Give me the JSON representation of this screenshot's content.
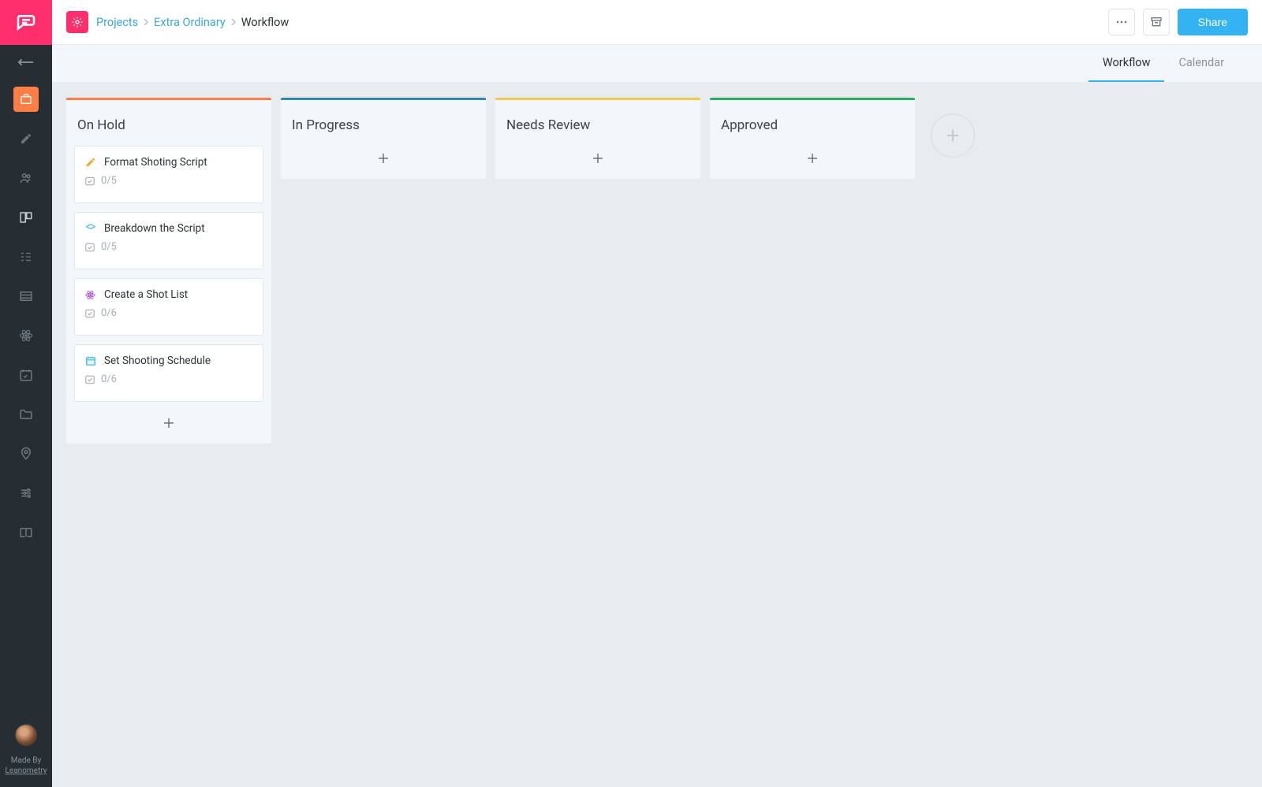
{
  "sidebar": {
    "credit_line1": "Made By",
    "credit_line2": "Leanometry"
  },
  "topbar": {
    "breadcrumb": {
      "root": "Projects",
      "project": "Extra Ordinary",
      "current": "Workflow"
    },
    "share_label": "Share"
  },
  "tabs": [
    {
      "label": "Workflow",
      "active": true
    },
    {
      "label": "Calendar",
      "active": false
    }
  ],
  "columns": [
    {
      "title": "On Hold",
      "color": "#ff7e45",
      "cards": [
        {
          "icon": "pencil",
          "icon_color": "#f5a623",
          "title": "Format Shoting Script",
          "progress": "0/5"
        },
        {
          "icon": "box",
          "icon_color": "#4ac1e0",
          "title": "Breakdown the Script",
          "progress": "0/5"
        },
        {
          "icon": "atom",
          "icon_color": "#b865d6",
          "title": "Create a Shot List",
          "progress": "0/6"
        },
        {
          "icon": "calendar",
          "icon_color": "#4ac1e0",
          "title": "Set Shooting Schedule",
          "progress": "0/6"
        }
      ]
    },
    {
      "title": "In Progress",
      "color": "#2e86ab",
      "cards": []
    },
    {
      "title": "Needs Review",
      "color": "#f2c94c",
      "cards": []
    },
    {
      "title": "Approved",
      "color": "#27ae60",
      "cards": []
    }
  ]
}
